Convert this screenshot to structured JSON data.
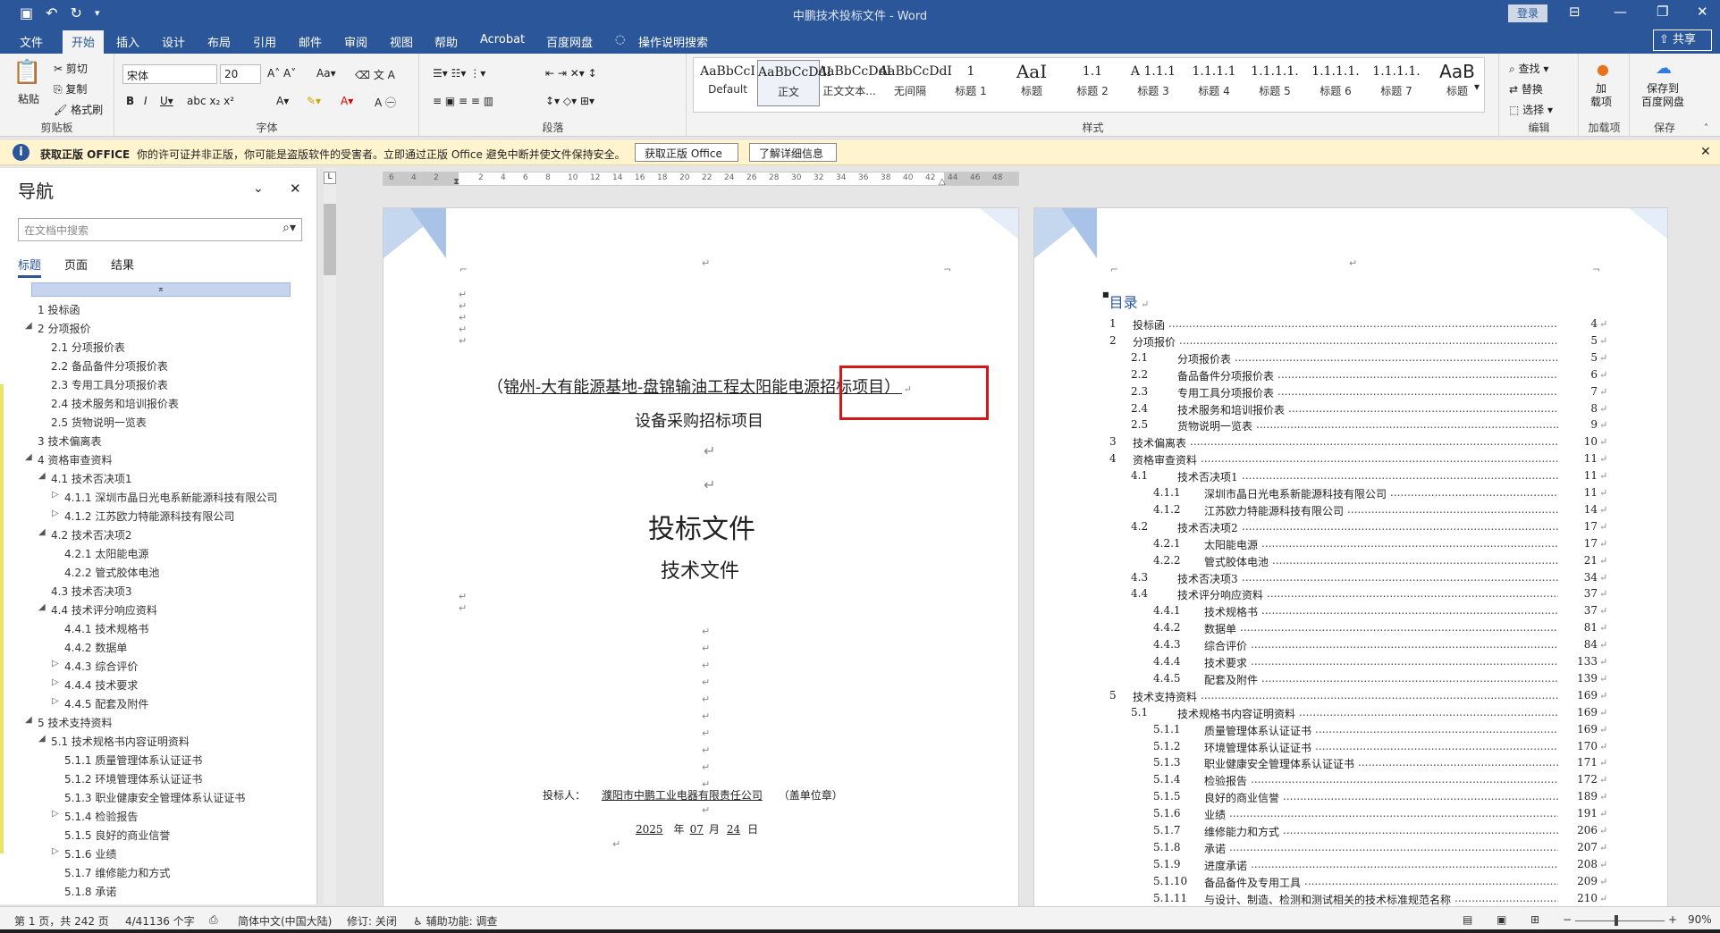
{
  "window": {
    "title": "中鹏技术投标文件 - Word",
    "login_button": "登录",
    "share_button": "共享"
  },
  "quick_access": {
    "save_icon": "save-icon",
    "undo_icon": "undo-icon",
    "redo_icon": "redo-icon"
  },
  "menu": {
    "items": [
      "文件",
      "开始",
      "插入",
      "设计",
      "布局",
      "引用",
      "邮件",
      "审阅",
      "视图",
      "帮助",
      "Acrobat",
      "百度网盘"
    ],
    "active": "开始",
    "tell_me": "操作说明搜索"
  },
  "ribbon": {
    "clipboard": {
      "paste": "粘贴",
      "cut": "剪切",
      "copy": "复制",
      "format_painter": "格式刷",
      "label": "剪贴板"
    },
    "font": {
      "name": "宋体",
      "size": "20",
      "label": "字体"
    },
    "paragraph": {
      "label": "段落"
    },
    "styles": {
      "label": "样式",
      "items": [
        {
          "preview": "AaBbCcI",
          "name": "Default"
        },
        {
          "preview": "AaBbCcDdI",
          "name": "正文"
        },
        {
          "preview": "AaBbCcDdI",
          "name": "正文文本..."
        },
        {
          "preview": "AaBbCcDdI",
          "name": "无间隔"
        },
        {
          "preview": "1",
          "name": "标题 1"
        },
        {
          "preview": "AaI",
          "name": "标题"
        },
        {
          "preview": "1.1",
          "name": "标题 2"
        },
        {
          "preview": "A 1.1.1",
          "name": "标题 3"
        },
        {
          "preview": "1.1.1.1",
          "name": "标题 4"
        },
        {
          "preview": "1.1.1.1.",
          "name": "标题 5"
        },
        {
          "preview": "1.1.1.1.",
          "name": "标题 6"
        },
        {
          "preview": "1.1.1.1.",
          "name": "标题 7"
        },
        {
          "preview": "AaB",
          "name": "标题"
        }
      ]
    },
    "editing": {
      "find": "查找",
      "replace": "替换",
      "select": "选择",
      "label": "编辑"
    },
    "addins": {
      "btn": "加\n载项",
      "label": "加载项"
    },
    "baidu": {
      "btn": "保存到\n百度网盘",
      "label": "保存"
    }
  },
  "warning": {
    "title": "获取正版 OFFICE",
    "message": "你的许可证并非正版，你可能是盗版软件的受害者。立即通过正版 Office 避免中断并使文件保持安全。",
    "btn_get": "获取正版 Office",
    "btn_more": "了解详细信息"
  },
  "nav": {
    "title": "导航",
    "search_placeholder": "在文档中搜索",
    "tabs": [
      "标题",
      "页面",
      "结果"
    ],
    "items": [
      {
        "text": "1 投标函",
        "level": 1,
        "arrow": ""
      },
      {
        "text": "2 分项报价",
        "level": 1,
        "arrow": "◢"
      },
      {
        "text": "2.1 分项报价表",
        "level": 2,
        "arrow": ""
      },
      {
        "text": "2.2 备品备件分项报价表",
        "level": 2,
        "arrow": ""
      },
      {
        "text": "2.3 专用工具分项报价表",
        "level": 2,
        "arrow": ""
      },
      {
        "text": "2.4 技术服务和培训报价表",
        "level": 2,
        "arrow": ""
      },
      {
        "text": "2.5 货物说明一览表",
        "level": 2,
        "arrow": ""
      },
      {
        "text": "3 技术偏离表",
        "level": 1,
        "arrow": ""
      },
      {
        "text": "4 资格审查资料",
        "level": 1,
        "arrow": "◢"
      },
      {
        "text": "4.1 技术否决项1",
        "level": 2,
        "arrow": "◢"
      },
      {
        "text": "4.1.1 深圳市晶日光电系新能源科技有限公司",
        "level": 3,
        "arrow": "▷"
      },
      {
        "text": "4.1.2 江苏欧力特能源科技有限公司",
        "level": 3,
        "arrow": "▷"
      },
      {
        "text": "4.2 技术否决项2",
        "level": 2,
        "arrow": "◢"
      },
      {
        "text": "4.2.1 太阳能电源",
        "level": 3,
        "arrow": ""
      },
      {
        "text": "4.2.2 管式胶体电池",
        "level": 3,
        "arrow": ""
      },
      {
        "text": "4.3 技术否决项3",
        "level": 2,
        "arrow": ""
      },
      {
        "text": "4.4 技术评分响应资料",
        "level": 2,
        "arrow": "◢"
      },
      {
        "text": "4.4.1 技术规格书",
        "level": 3,
        "arrow": ""
      },
      {
        "text": "4.4.2 数据单",
        "level": 3,
        "arrow": ""
      },
      {
        "text": "4.4.3 综合评价",
        "level": 3,
        "arrow": "▷"
      },
      {
        "text": "4.4.4 技术要求",
        "level": 3,
        "arrow": "▷"
      },
      {
        "text": "4.4.5 配套及附件",
        "level": 3,
        "arrow": "▷"
      },
      {
        "text": "5 技术支持资料",
        "level": 1,
        "arrow": "◢"
      },
      {
        "text": "5.1 技术规格书内容证明资料",
        "level": 2,
        "arrow": "◢"
      },
      {
        "text": "5.1.1 质量管理体系认证证书",
        "level": 3,
        "arrow": ""
      },
      {
        "text": "5.1.2 环境管理体系认证证书",
        "level": 3,
        "arrow": ""
      },
      {
        "text": "5.1.3 职业健康安全管理体系认证证书",
        "level": 3,
        "arrow": ""
      },
      {
        "text": "5.1.4 检验报告",
        "level": 3,
        "arrow": "▷"
      },
      {
        "text": "5.1.5 良好的商业信誉",
        "level": 3,
        "arrow": ""
      },
      {
        "text": "5.1.6 业绩",
        "level": 3,
        "arrow": "▷"
      },
      {
        "text": "5.1.7 维修能力和方式",
        "level": 3,
        "arrow": ""
      },
      {
        "text": "5.1.8 承诺",
        "level": 3,
        "arrow": ""
      }
    ]
  },
  "ruler": {
    "ticks": [
      "6",
      "4",
      "2",
      "",
      "2",
      "4",
      "6",
      "8",
      "10",
      "12",
      "14",
      "16",
      "18",
      "20",
      "22",
      "24",
      "26",
      "28",
      "30",
      "32",
      "34",
      "36",
      "38",
      "40",
      "42",
      "44",
      "46",
      "48"
    ]
  },
  "page1": {
    "project_line": "（锦州-大有能源基地-盘锦输油工程太阳能电源招标项目）",
    "subtitle": "设备采购招标项目",
    "title": "投标文件",
    "subtitle2": "技术文件",
    "bidder_label": "投标人：",
    "bidder_name": "濮阳市中鹏工业电器有限责任公司",
    "bidder_seal": "（盖单位章）",
    "year": "2025",
    "year_label": "年",
    "month": "07",
    "month_label": "月",
    "day": "24",
    "day_label": "日"
  },
  "page2": {
    "toc_title": "目录",
    "entries": [
      {
        "n": "1",
        "t": "投标函",
        "p": "4",
        "lvl": 1
      },
      {
        "n": "2",
        "t": "分项报价",
        "p": "5",
        "lvl": 1
      },
      {
        "n": "2.1",
        "t": "分项报价表",
        "p": "5",
        "lvl": 2
      },
      {
        "n": "2.2",
        "t": "备品备件分项报价表",
        "p": "6",
        "lvl": 2
      },
      {
        "n": "2.3",
        "t": "专用工具分项报价表",
        "p": "7",
        "lvl": 2
      },
      {
        "n": "2.4",
        "t": "技术服务和培训报价表",
        "p": "8",
        "lvl": 2
      },
      {
        "n": "2.5",
        "t": "货物说明一览表",
        "p": "9",
        "lvl": 2
      },
      {
        "n": "3",
        "t": "技术偏离表",
        "p": "10",
        "lvl": 1
      },
      {
        "n": "4",
        "t": "资格审查资料",
        "p": "11",
        "lvl": 1
      },
      {
        "n": "4.1",
        "t": "技术否决项1",
        "p": "11",
        "lvl": 2
      },
      {
        "n": "4.1.1",
        "t": "深圳市晶日光电系新能源科技有限公司",
        "p": "11",
        "lvl": 3
      },
      {
        "n": "4.1.2",
        "t": "江苏欧力特能源科技有限公司",
        "p": "14",
        "lvl": 3
      },
      {
        "n": "4.2",
        "t": "技术否决项2",
        "p": "17",
        "lvl": 2
      },
      {
        "n": "4.2.1",
        "t": "太阳能电源",
        "p": "17",
        "lvl": 3
      },
      {
        "n": "4.2.2",
        "t": "管式胶体电池",
        "p": "21",
        "lvl": 3
      },
      {
        "n": "4.3",
        "t": "技术否决项3",
        "p": "34",
        "lvl": 2
      },
      {
        "n": "4.4",
        "t": "技术评分响应资料",
        "p": "37",
        "lvl": 2
      },
      {
        "n": "4.4.1",
        "t": "技术规格书",
        "p": "37",
        "lvl": 3
      },
      {
        "n": "4.4.2",
        "t": "数据单",
        "p": "81",
        "lvl": 3
      },
      {
        "n": "4.4.3",
        "t": "综合评价",
        "p": "84",
        "lvl": 3
      },
      {
        "n": "4.4.4",
        "t": "技术要求",
        "p": "133",
        "lvl": 3
      },
      {
        "n": "4.4.5",
        "t": "配套及附件",
        "p": "139",
        "lvl": 3
      },
      {
        "n": "5",
        "t": "技术支持资料",
        "p": "169",
        "lvl": 1
      },
      {
        "n": "5.1",
        "t": "技术规格书内容证明资料",
        "p": "169",
        "lvl": 2
      },
      {
        "n": "5.1.1",
        "t": "质量管理体系认证证书",
        "p": "169",
        "lvl": 3
      },
      {
        "n": "5.1.2",
        "t": "环境管理体系认证证书",
        "p": "170",
        "lvl": 3
      },
      {
        "n": "5.1.3",
        "t": "职业健康安全管理体系认证证书",
        "p": "171",
        "lvl": 3
      },
      {
        "n": "5.1.4",
        "t": "检验报告",
        "p": "172",
        "lvl": 3
      },
      {
        "n": "5.1.5",
        "t": "良好的商业信誉",
        "p": "189",
        "lvl": 3
      },
      {
        "n": "5.1.6",
        "t": "业绩",
        "p": "191",
        "lvl": 3
      },
      {
        "n": "5.1.7",
        "t": "维修能力和方式",
        "p": "206",
        "lvl": 3
      },
      {
        "n": "5.1.8",
        "t": "承诺",
        "p": "207",
        "lvl": 3
      },
      {
        "n": "5.1.9",
        "t": "进度承诺",
        "p": "208",
        "lvl": 3
      },
      {
        "n": "5.1.10",
        "t": "备品备件及专用工具",
        "p": "209",
        "lvl": 3
      },
      {
        "n": "5.1.11",
        "t": "与设计、制造、检测和测试相关的技术标准规范名称",
        "p": "210",
        "lvl": 3
      }
    ]
  },
  "status": {
    "page": "第 1 页，共 242 页",
    "words": "4/41136 个字",
    "lang": "简体中文(中国大陆)",
    "track": "修订: 关闭",
    "access": "辅助功能: 调查",
    "zoom": "90%"
  },
  "colors": {
    "accent": "#2b579a",
    "warning_bg": "#fff4ce",
    "highlight_red": "#d21a1a"
  }
}
